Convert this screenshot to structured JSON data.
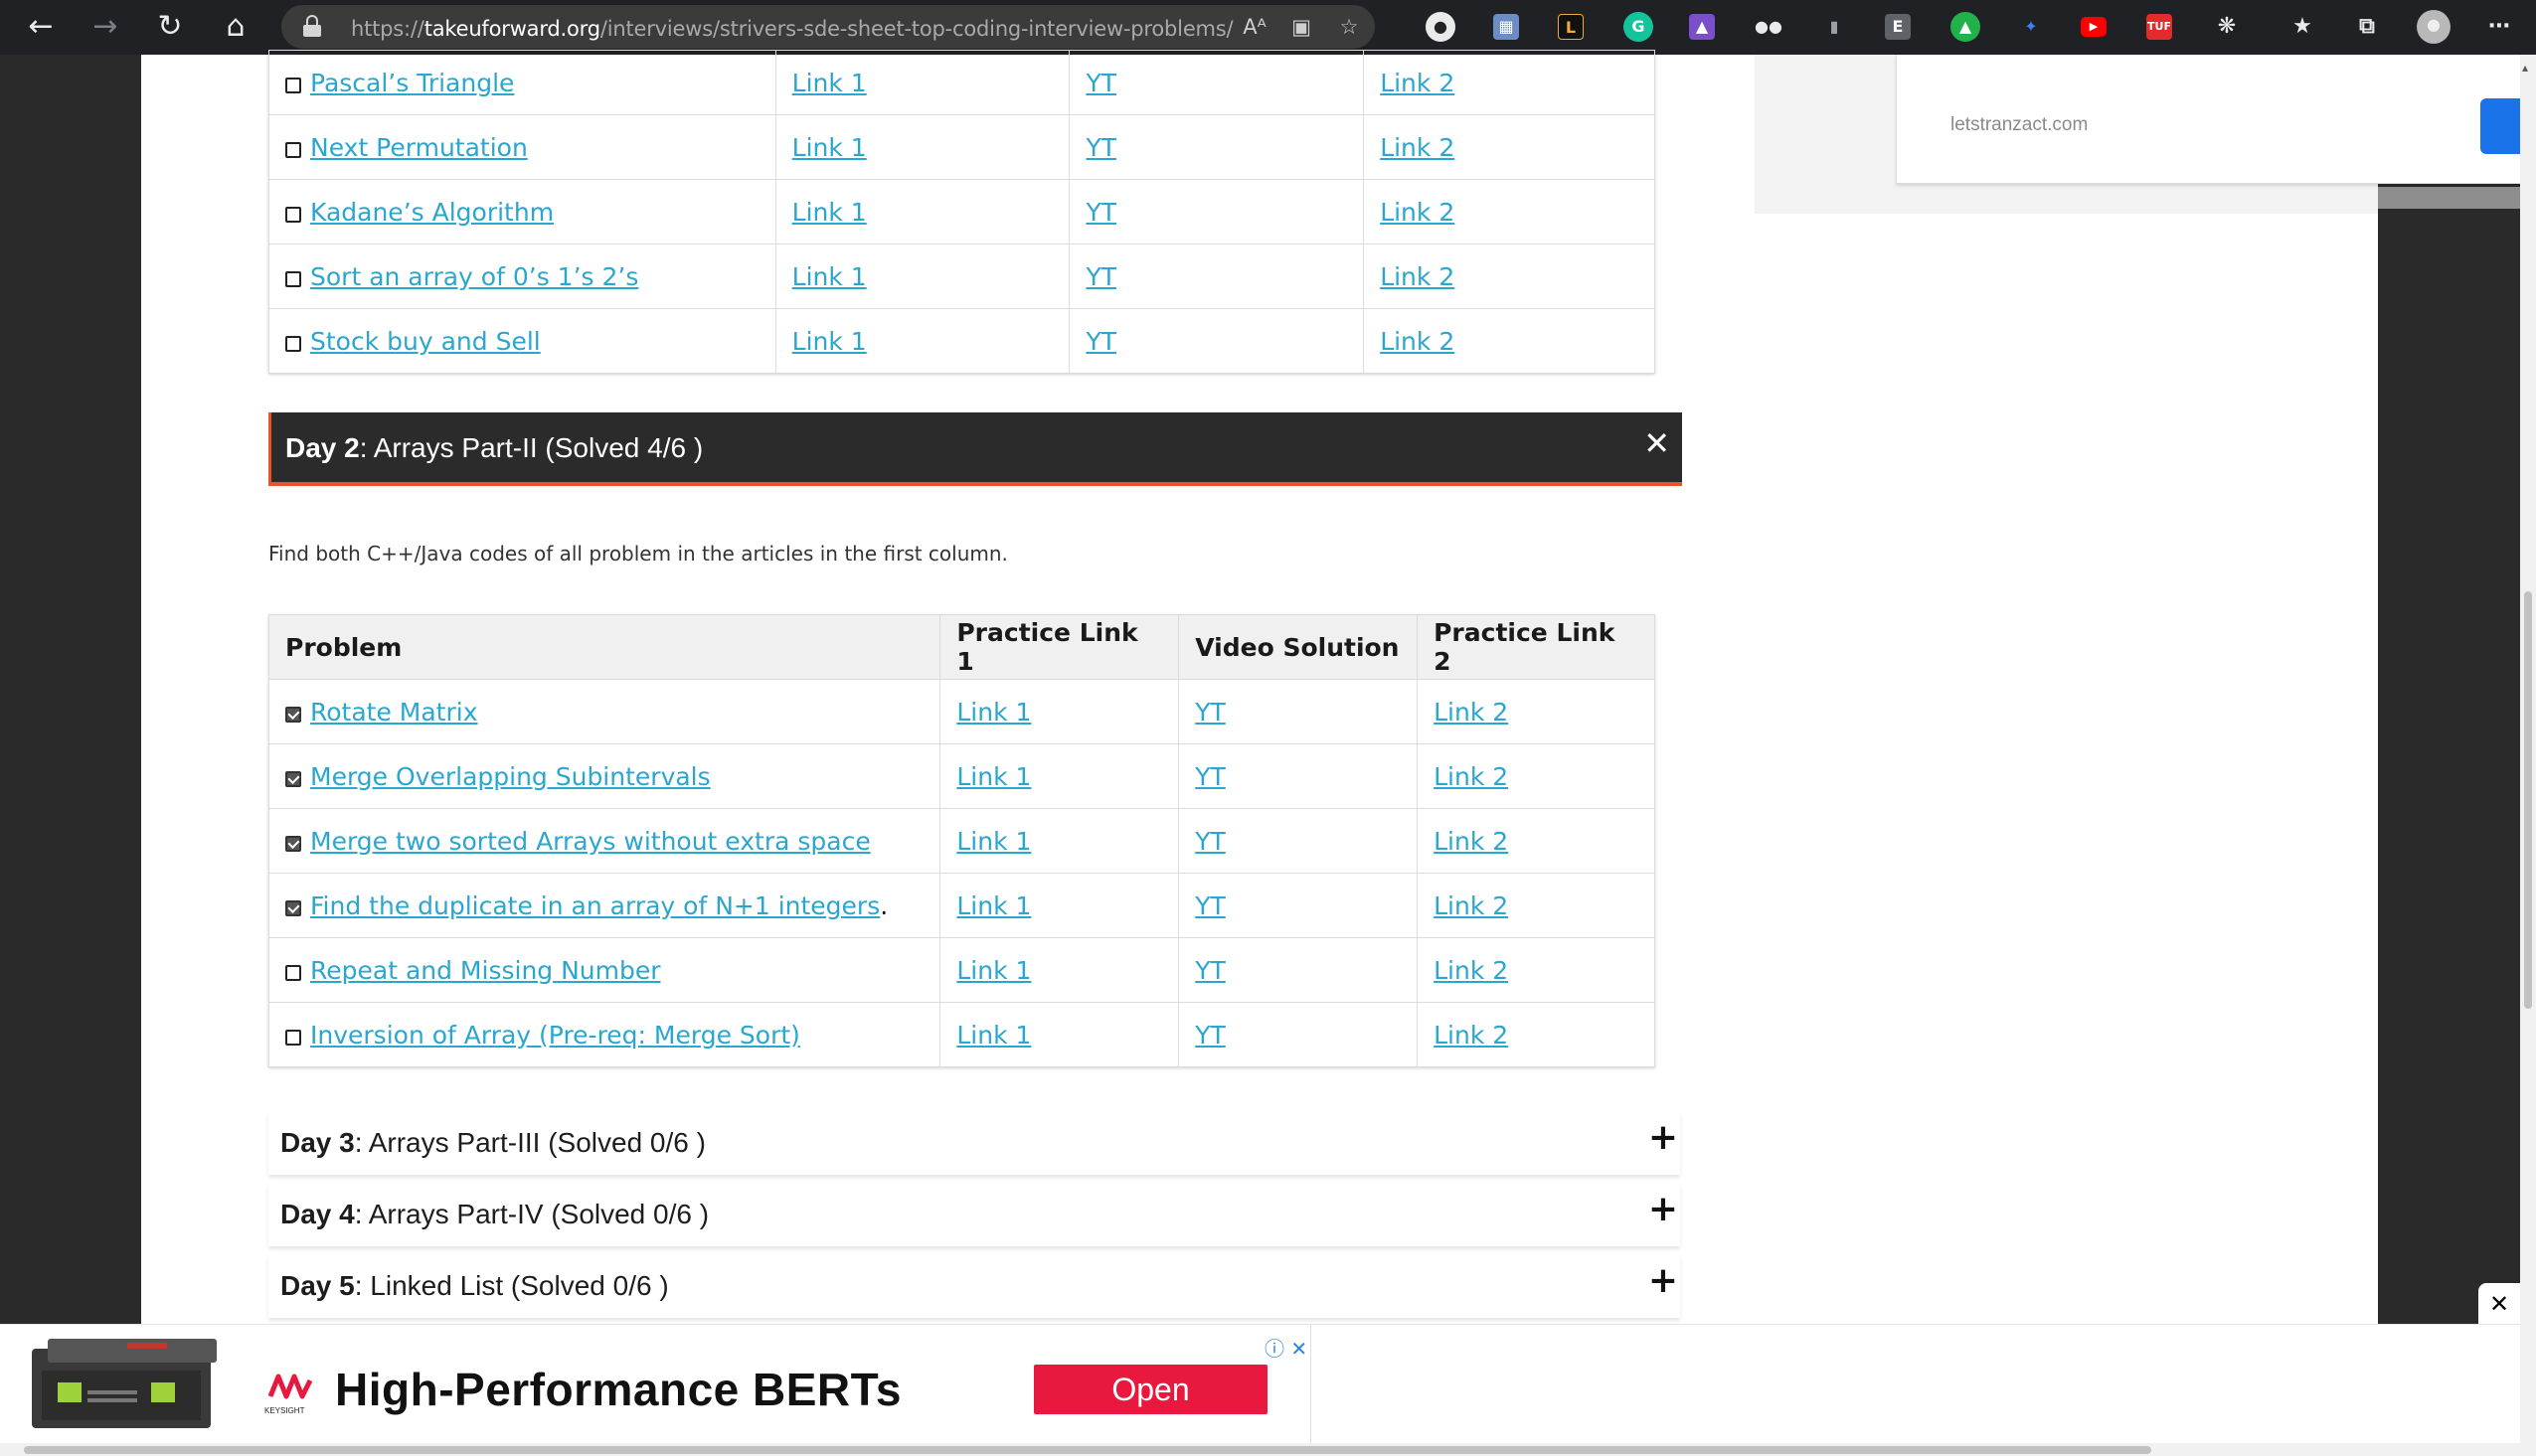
{
  "browser": {
    "url_prefix": "https://",
    "url_host": "takeuforward.org",
    "url_path": "/interviews/strivers-sde-sheet-top-coding-interview-problems/",
    "read_aloud": "Aᴬ"
  },
  "sidebar": {
    "ad_domain": "letstranzact.com"
  },
  "day1": {
    "rows": [
      {
        "problem": "Pascal’s Triangle",
        "checked": false,
        "link1": "Link 1",
        "video": "YT",
        "link2": "Link 2"
      },
      {
        "problem": "Next Permutation",
        "checked": false,
        "link1": "Link 1",
        "video": "YT",
        "link2": "Link 2"
      },
      {
        "problem": "Kadane’s Algorithm",
        "checked": false,
        "link1": "Link 1",
        "video": "YT",
        "link2": "Link 2"
      },
      {
        "problem": "Sort an array of 0’s 1’s 2’s",
        "checked": false,
        "link1": "Link 1",
        "video": "YT",
        "link2": "Link 2"
      },
      {
        "problem": "Stock buy and Sell",
        "checked": false,
        "link1": "Link 1",
        "video": "YT",
        "link2": "Link 2"
      }
    ]
  },
  "day2": {
    "day_label": "Day 2",
    "title": ": Arrays Part-II (Solved 4/6 )",
    "close_symbol": "✕",
    "description": "Find both C++/Java codes of all problem in the articles in the first column.",
    "headers": [
      "Problem",
      "Practice Link 1",
      "Video Solution",
      "Practice Link 2"
    ],
    "rows": [
      {
        "problem": "Rotate Matrix",
        "suffix": "",
        "checked": true,
        "link1": "Link 1",
        "video": "YT",
        "link2": "Link 2"
      },
      {
        "problem": "Merge Overlapping Subintervals",
        "suffix": "",
        "checked": true,
        "link1": "Link 1",
        "video": "YT",
        "link2": "Link 2"
      },
      {
        "problem": "Merge two sorted Arrays without extra space",
        "suffix": "",
        "checked": true,
        "link1": "Link 1",
        "video": "YT",
        "link2": "Link 2"
      },
      {
        "problem": "Find the duplicate in an array of N+1 integers",
        "suffix": ".",
        "checked": true,
        "link1": "Link 1",
        "video": "YT",
        "link2": "Link 2"
      },
      {
        "problem": "Repeat and Missing Number",
        "suffix": "",
        "checked": false,
        "link1": "Link 1",
        "video": "YT",
        "link2": "Link 2"
      },
      {
        "problem": "Inversion of Array (Pre-req: Merge Sort)",
        "suffix": "",
        "checked": false,
        "link1": "Link 1",
        "video": "YT",
        "link2": "Link 2"
      }
    ]
  },
  "collapsed_days": [
    {
      "day_label": "Day 3",
      "title": ": Arrays Part-III (Solved 0/6 )",
      "expand_symbol": "+"
    },
    {
      "day_label": "Day 4",
      "title": ": Arrays Part-IV (Solved 0/6 )",
      "expand_symbol": "+"
    },
    {
      "day_label": "Day 5",
      "title": ": Linked List (Solved 0/6 )",
      "expand_symbol": "+"
    }
  ],
  "bottom_ad": {
    "headline": "High-Performance BERTs",
    "cta": "Open",
    "brand": "KEYSIGHT",
    "adchoices": "ⓘ ✕"
  },
  "float_close": "✕",
  "colors": {
    "link": "#2aa6cf",
    "accent": "#e8542a",
    "cta": "#e8183f"
  }
}
